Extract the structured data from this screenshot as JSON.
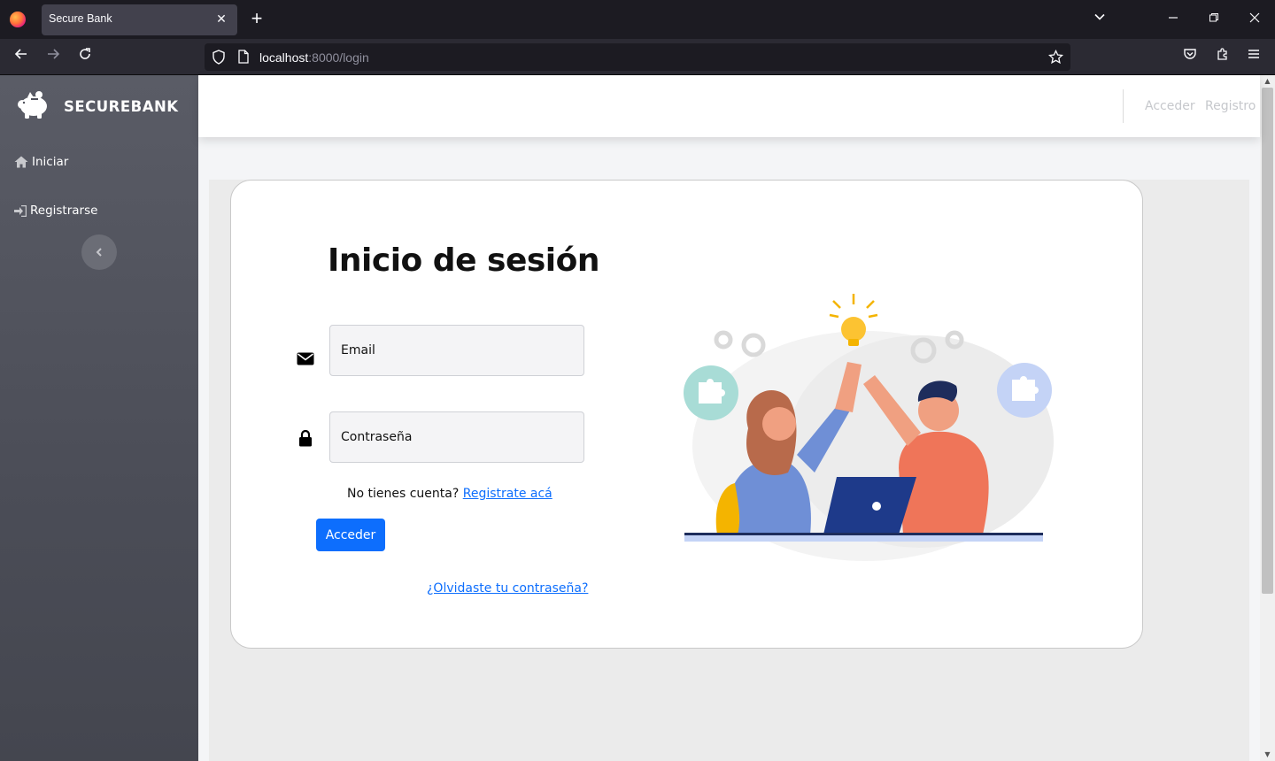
{
  "browser": {
    "tab_title": "Secure Bank",
    "url_host": "localhost",
    "url_path": ":8000/login"
  },
  "sidebar": {
    "brand": "SECUREBANK",
    "items": [
      {
        "label": "Iniciar",
        "icon": "home-icon"
      },
      {
        "label": "Registrarse",
        "icon": "sign-in-icon"
      }
    ]
  },
  "topbar": {
    "login_link": "Acceder",
    "register_link": "Registro"
  },
  "login": {
    "title": "Inicio de sesión",
    "email_placeholder": "Email",
    "password_placeholder": "Contraseña",
    "no_account_text": "No tienes cuenta?",
    "register_link": "Registrate acá",
    "submit_label": "Acceder",
    "forgot_link": "¿Olvidaste tu contraseña?"
  },
  "colors": {
    "primary": "#0d6efd",
    "sidebar": "#4f515b"
  }
}
